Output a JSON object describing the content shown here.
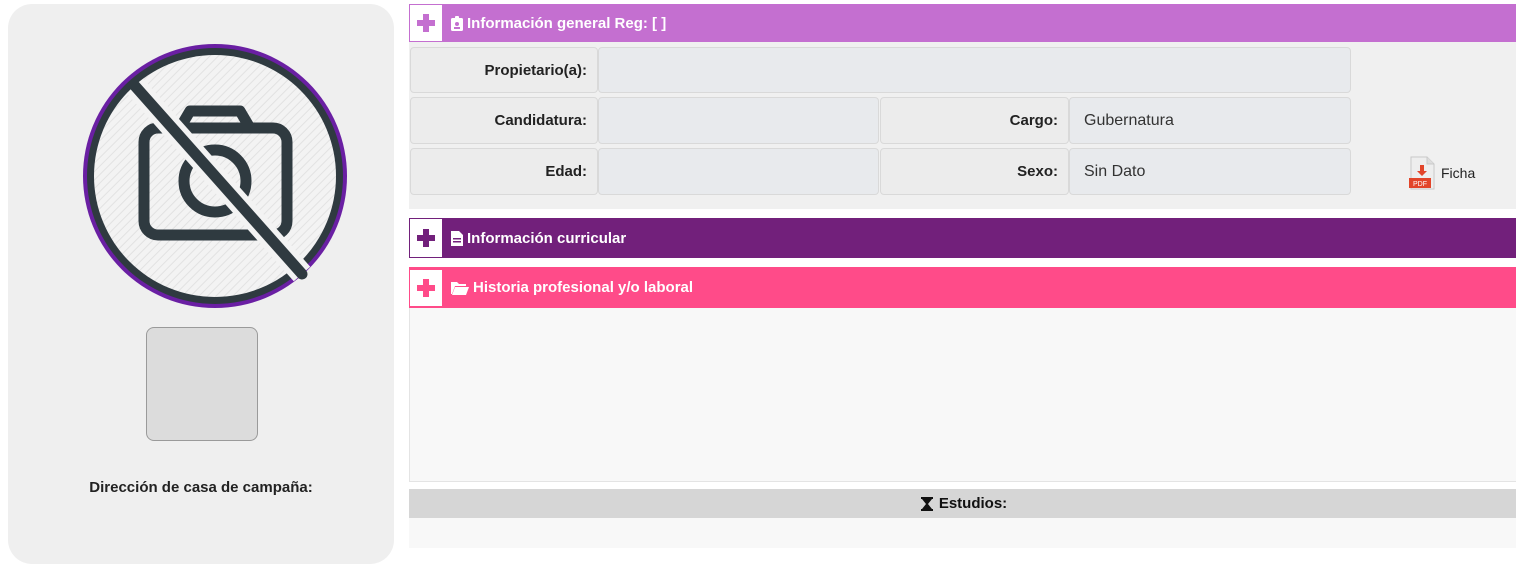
{
  "sidebar": {
    "direccion_label": "Dirección de casa de campaña:"
  },
  "general": {
    "title": "Información general Reg: [ ]",
    "propietario_label": "Propietario(a):",
    "propietario_value": "",
    "candidatura_label": "Candidatura:",
    "candidatura_value": "",
    "cargo_label": "Cargo:",
    "cargo_value": "Gubernatura",
    "edad_label": "Edad:",
    "edad_value": "",
    "sexo_label": "Sexo:",
    "sexo_value": "Sin Dato",
    "ficha_label": "Ficha"
  },
  "curricular": {
    "title": "Información curricular"
  },
  "historia": {
    "title": "Historia profesional y/o laboral"
  },
  "estudios": {
    "title": "Estudios:"
  },
  "icons": [
    "no-photo-icon",
    "plus-icon",
    "id-badge-icon",
    "file-icon",
    "folder-open-icon",
    "pdf-icon",
    "hourglass-icon"
  ],
  "colors": {
    "general_header": "#c46fd0",
    "curricular_header": "#72207b",
    "historia_header": "#ff4b89",
    "photo_ring": "#6a1fa3"
  }
}
